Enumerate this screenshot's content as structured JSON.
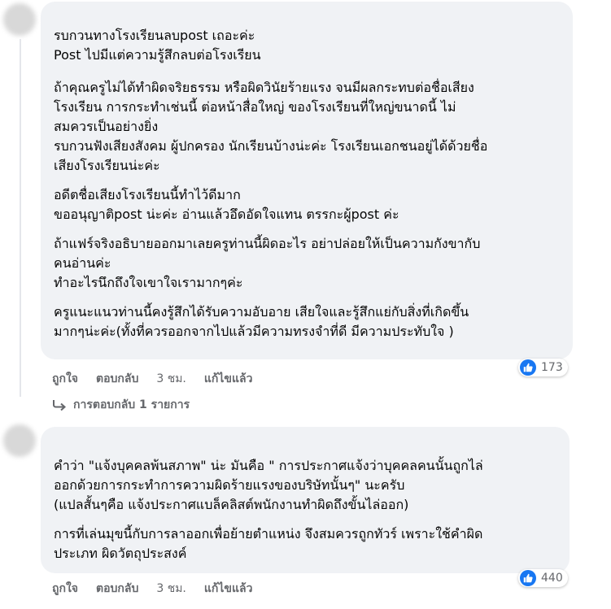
{
  "comments": [
    {
      "paragraphs": [
        [
          "รบกวนทางโรงเรียนลบpost เถอะค่ะ",
          "Post ไปมีแต่ความรู้สึกลบต่อโรงเรียน"
        ],
        [
          "ถ้าคุณครูไม่ได้ทำผิดจริยธรรม หรือผิดวินัยร้ายแรง จนมีผลกระทบต่อชื่อเสียง",
          "โรงเรียน การกระทำเช่นนี้ ต่อหน้าสื่อใหญ่ ของโรงเรียนที่ใหญ่ขนาดนี้ ไม่",
          "สมควรเป็นอย่างยิ่ง",
          "รบกวนฟังเสียงสังคม ผู้ปกครอง นักเรียนบ้างน่ะค่ะ โรงเรียนเอกชนอยู่ได้ด้วยชื่อ",
          "เสียงโรงเรียนน่ะค่ะ"
        ],
        [
          "อดีตชื่อเสียงโรงเรียนนี้ทำไว้ดีมาก",
          "ขออนุญาติpost น่ะค่ะ อ่านแล้วอึดอัดใจแทน ตรรกะผู้post ค่ะ"
        ],
        [
          "ถ้าแฟร์จริงอธิบายออกมาเลยครูท่านนี้ผิดอะไร อย่าปล่อยให้เป็นความกังขากับ",
          "คนอ่านค่ะ",
          "ทำอะไรนึกถึงใจเขาใจเรามากๆค่ะ"
        ],
        [
          "ครูแนะแนวท่านนี้คงรู้สึกได้รับความอับอาย เสียใจและรู้สึกแย่กับสิ่งที่เกิดขึ้น",
          "มากๆน่ะค่ะ(ทั้งที่ควรออกจากไปแล้วมีความทรงจำที่ดี มีความประทับใจ )"
        ]
      ],
      "actions": {
        "like": "ถูกใจ",
        "reply": "ตอบกลับ",
        "time": "3 ชม.",
        "edited": "แก้ไขแล้ว"
      },
      "reaction_count": "173",
      "replies_link": "การตอบกลับ 1 รายการ"
    },
    {
      "paragraphs": [
        [
          "คำว่า \"แจ้งบุคคลพ้นสภาพ\" น่ะ มันคือ \" การประกาศแจ้งว่าบุคคลคนนั้นถูกไล่",
          "ออกด้วยการกระทำการความผิดร้ายแรงของบริษัทนั้นๆ\" นะครับ",
          "(แปลสั้นๆคือ แจ้งประกาศแบล็คลิสต์พนักงานทำผิดถึงขั้นไล่ออก)"
        ],
        [
          "การที่เล่นมุขนี้กับการลาออกเพื่อย้ายตำแหน่ง จึงสมควรถูกทัวร์ เพราะใช้คำผิด",
          "ประเภท ผิดวัตถุประสงค์"
        ]
      ],
      "actions": {
        "like": "ถูกใจ",
        "reply": "ตอบกลับ",
        "time": "3 ชม.",
        "edited": "แก้ไขแล้ว"
      },
      "reaction_count": "440"
    }
  ],
  "colors": {
    "bubble": "#f0f2f5",
    "meta": "#65676b",
    "like": "#1877f2"
  },
  "icons": {
    "reaction": "thumbs-up-icon",
    "reply_arrow": "reply-arrow-icon"
  }
}
